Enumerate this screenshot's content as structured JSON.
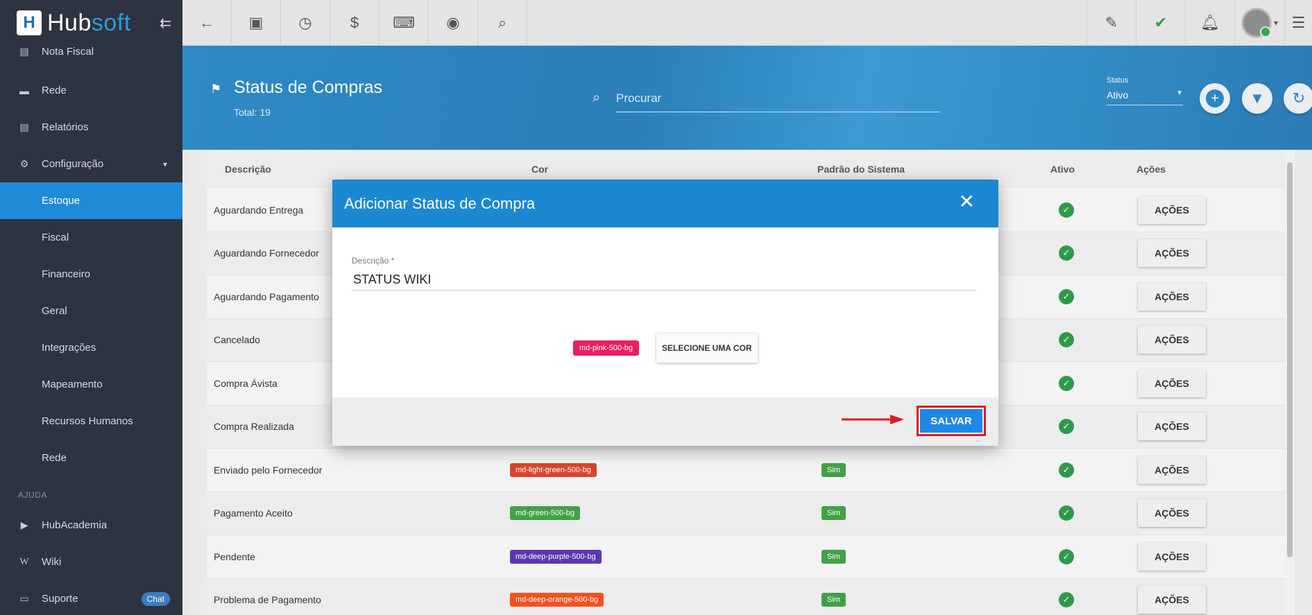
{
  "brand": {
    "name_part1": "Hub",
    "name_part2": "soft"
  },
  "sidebar": {
    "items": [
      {
        "label": "Nota Fiscal",
        "icon": "document-icon"
      },
      {
        "label": "Rede",
        "icon": "network-icon"
      },
      {
        "label": "Relatórios",
        "icon": "report-icon"
      },
      {
        "label": "Configuração",
        "icon": "gear-icon"
      }
    ],
    "sub_items": [
      "Estoque",
      "Fiscal",
      "Financeiro",
      "Geral",
      "Integrações",
      "Mapeamento",
      "Recursos Humanos",
      "Rede"
    ],
    "section_label": "AJUDA",
    "help_items": [
      {
        "label": "HubAcademia",
        "icon": "youtube-icon"
      },
      {
        "label": "Wiki",
        "icon": "wiki-icon"
      },
      {
        "label": "Suporte",
        "icon": "support-icon"
      }
    ],
    "chat_badge": "Chat"
  },
  "header": {
    "title": "Status de Compras",
    "total": "Total: 19",
    "search_placeholder": "Procurar",
    "status_label": "Status",
    "status_value": "Ativo"
  },
  "table": {
    "headers": [
      "Descrição",
      "Cor",
      "Padrão do Sistema",
      "Ativo",
      "Ações"
    ],
    "rows": [
      {
        "desc": "Aguardando Entrega",
        "cor": "",
        "cor_color": "",
        "padrao": ""
      },
      {
        "desc": "Aguardando Fornecedor",
        "cor": "",
        "cor_color": "",
        "padrao": ""
      },
      {
        "desc": "Aguardando Pagamento",
        "cor": "",
        "cor_color": "",
        "padrao": ""
      },
      {
        "desc": "Cancelado",
        "cor": "",
        "cor_color": "",
        "padrao": ""
      },
      {
        "desc": "Compra Ávista",
        "cor": "",
        "cor_color": "",
        "padrao": ""
      },
      {
        "desc": "Compra Realizada",
        "cor": "",
        "cor_color": "",
        "padrao": ""
      },
      {
        "desc": "Enviado pelo Fornecedor",
        "cor": "md-light-green-500-bg",
        "cor_color": "#d9442f",
        "padrao": "Sim"
      },
      {
        "desc": "Pagamento Aceito",
        "cor": "md-green-500-bg",
        "cor_color": "#43a047",
        "padrao": "Sim"
      },
      {
        "desc": "Pendente",
        "cor": "md-deep-purple-500-bg",
        "cor_color": "#5e35b1",
        "padrao": "Sim"
      },
      {
        "desc": "Problema de Pagamento",
        "cor": "md-deep-orange-500-bg",
        "cor_color": "#f4511e",
        "padrao": "Sim"
      }
    ],
    "action_label": "AÇÕES"
  },
  "modal": {
    "title": "Adicionar Status de Compra",
    "field_label": "Descrição *",
    "field_value": "STATUS WIKI",
    "color_chip": "md-pink-500-bg",
    "select_color_label": "SELECIONE UMA COR",
    "save_label": "SALVAR"
  },
  "colors": {
    "primary": "#1c88d1",
    "sidebar_bg": "#2d3340",
    "highlight": "#e01b1b"
  }
}
